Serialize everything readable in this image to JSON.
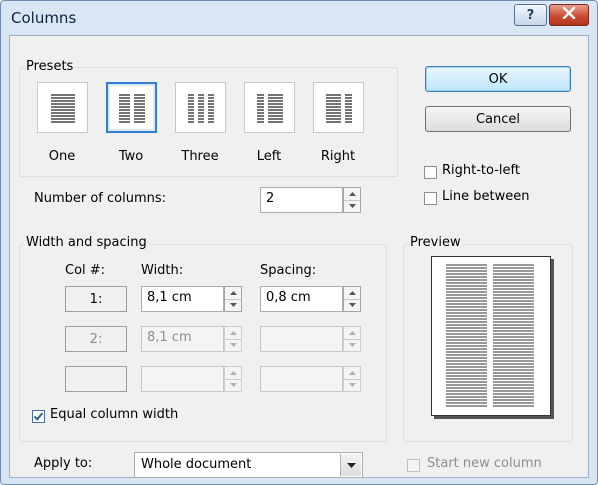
{
  "window": {
    "title": "Columns",
    "help_label": "?",
    "close_label": "x"
  },
  "presets": {
    "label": "Presets",
    "items": [
      {
        "label": "One",
        "accel": "O"
      },
      {
        "label": "Two",
        "accel": "w",
        "selected": true
      },
      {
        "label": "Three",
        "accel": "T"
      },
      {
        "label": "Left",
        "accel": "L"
      },
      {
        "label": "Right",
        "accel": "R"
      }
    ]
  },
  "buttons": {
    "ok": "OK",
    "cancel": "Cancel"
  },
  "options": {
    "right_to_left": "Right-to-left",
    "line_between": "Line between"
  },
  "number_of_columns": {
    "label": "Number of columns:",
    "value": "2"
  },
  "width_spacing": {
    "label": "Width and spacing",
    "col_header": "Col #:",
    "width_header": "Width:",
    "spacing_header": "Spacing:",
    "rows": [
      {
        "col": "1:",
        "width": "8,1 cm",
        "spacing": "0,8 cm"
      },
      {
        "col": "2:",
        "width": "8,1 cm",
        "spacing": ""
      },
      {
        "col": "",
        "width": "",
        "spacing": ""
      }
    ]
  },
  "equal_column_width": {
    "label": "Equal column width",
    "checked": true
  },
  "preview": {
    "label": "Preview"
  },
  "apply_to": {
    "label": "Apply to:",
    "value": "Whole document"
  },
  "start_new_column": {
    "label": "Start new column",
    "checked": false
  },
  "colors": {
    "accent": "#2f7fd0",
    "close": "#c94d34",
    "frame": "#d9e6f4"
  }
}
